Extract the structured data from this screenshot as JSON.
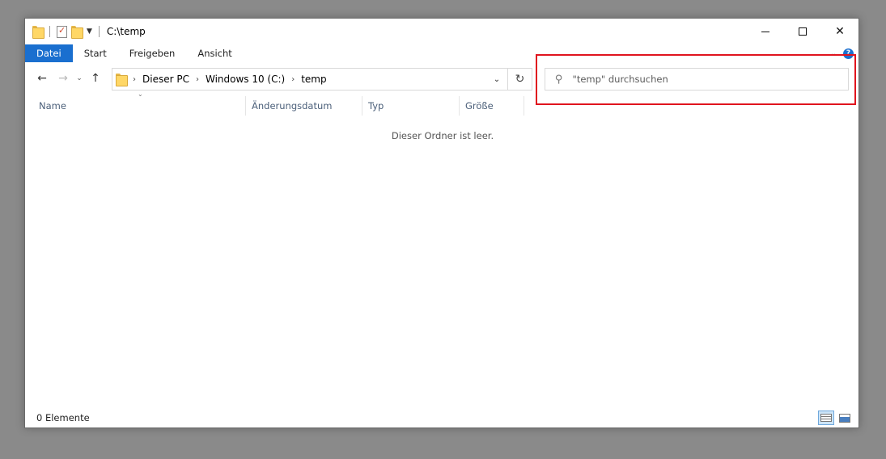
{
  "window": {
    "title": "C:\\temp",
    "controls": {
      "minimize": "—",
      "maximize": "□",
      "close": "✕"
    }
  },
  "ribbon": {
    "tabs": [
      {
        "label": "Datei",
        "active": true
      },
      {
        "label": "Start"
      },
      {
        "label": "Freigeben"
      },
      {
        "label": "Ansicht"
      }
    ],
    "help_label": "?"
  },
  "nav": {
    "back": "←",
    "forward": "→",
    "recent": "⌄",
    "up": "↑",
    "breadcrumb": [
      "Dieser PC",
      "Windows 10 (C:)",
      "temp"
    ],
    "refresh": "↻"
  },
  "search": {
    "placeholder": "\"temp\" durchsuchen",
    "value": ""
  },
  "columns": [
    "Name",
    "Änderungsdatum",
    "Typ",
    "Größe"
  ],
  "content": {
    "empty_message": "Dieser Ordner ist leer."
  },
  "status": {
    "item_count": "0 Elemente"
  },
  "colors": {
    "accent": "#1a6fcf",
    "highlight": "#e0141e",
    "folder": "#ffd766"
  }
}
